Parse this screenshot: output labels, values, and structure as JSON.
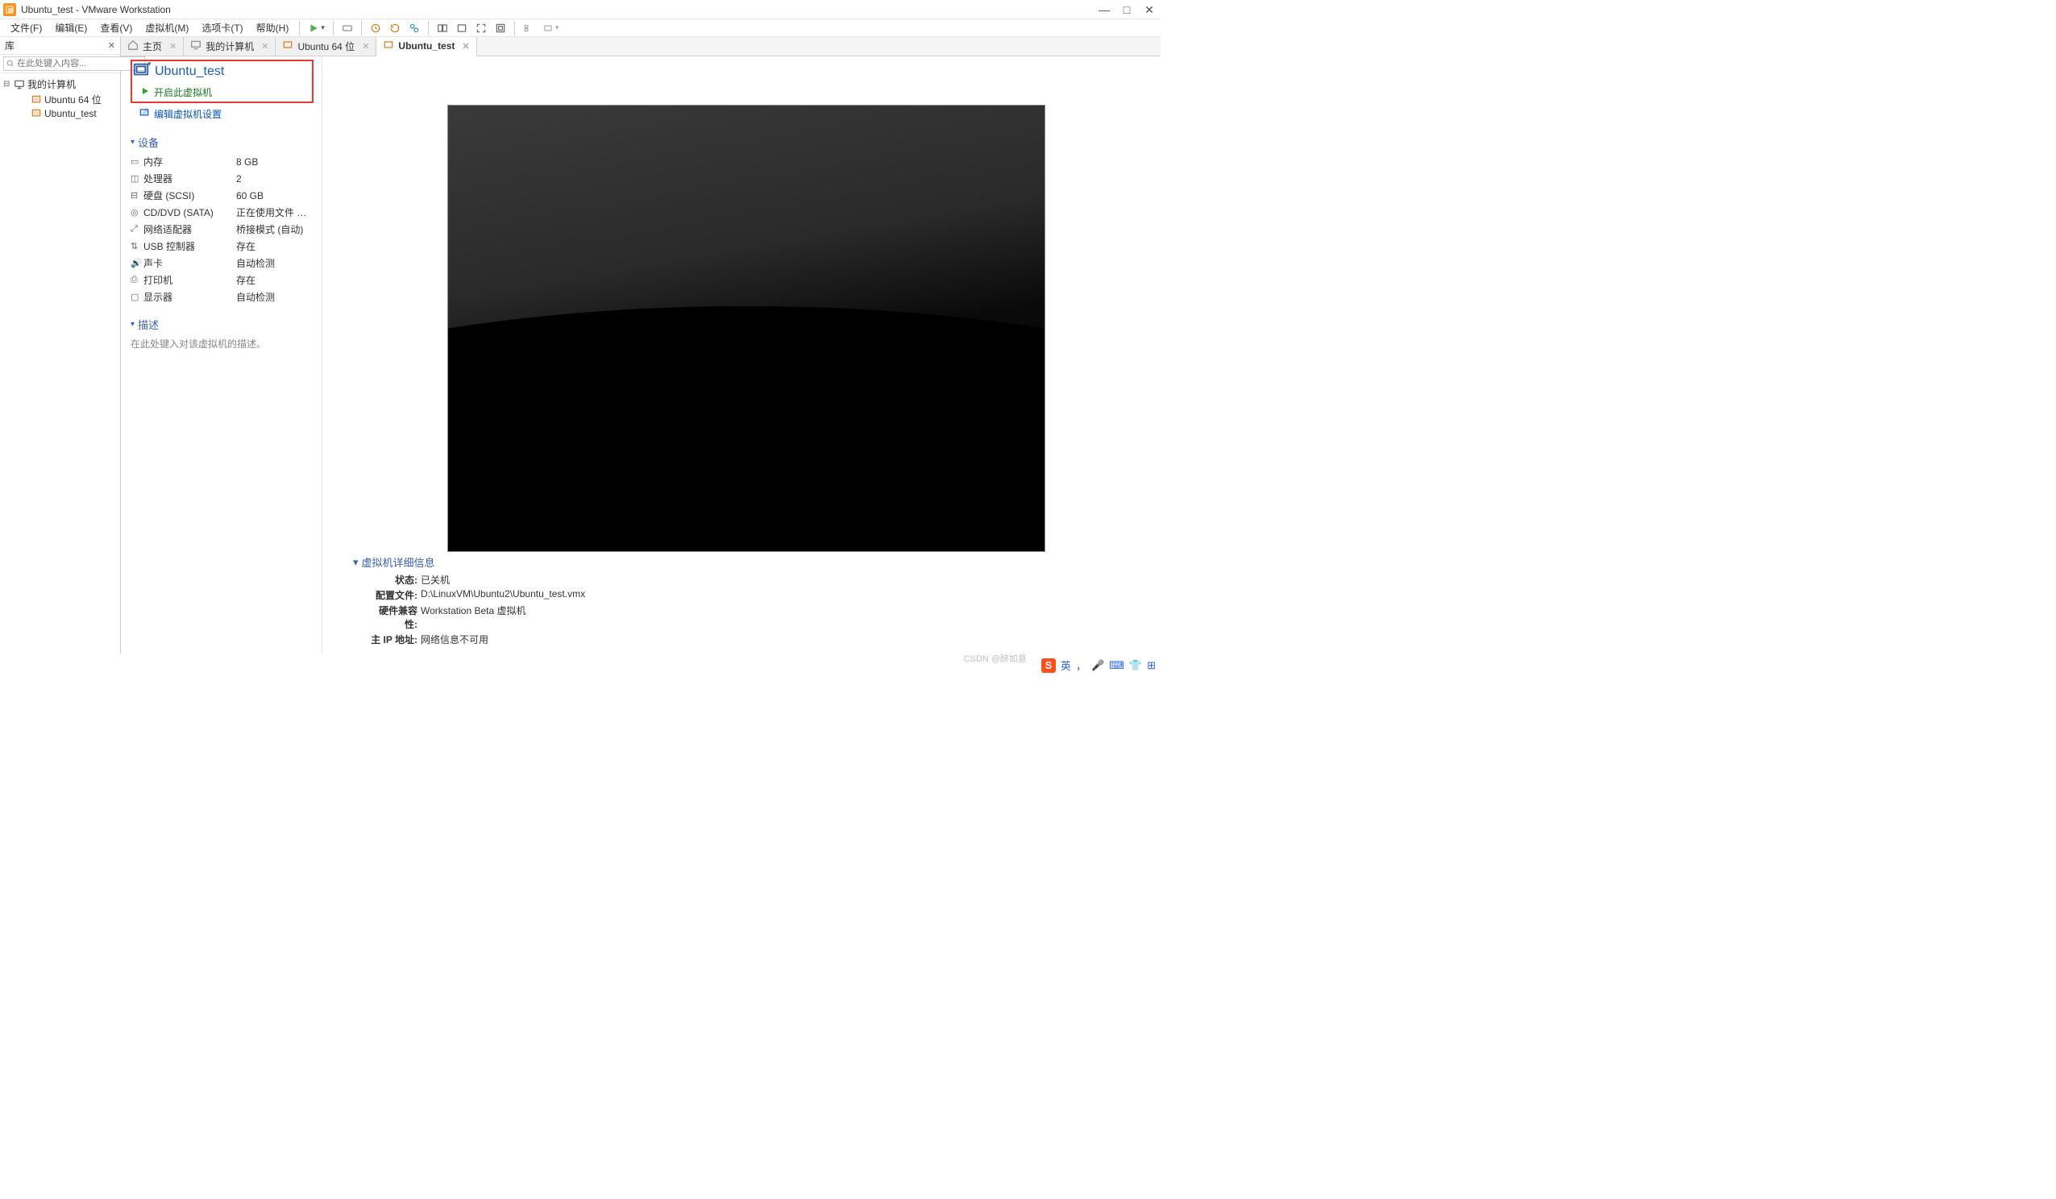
{
  "window": {
    "title": "Ubuntu_test - VMware Workstation"
  },
  "menu": {
    "file": "文件(F)",
    "edit": "编辑(E)",
    "view": "查看(V)",
    "vm": "虚拟机(M)",
    "tabs": "选项卡(T)",
    "help": "帮助(H)"
  },
  "library": {
    "header": "库",
    "search_placeholder": "在此处键入内容...",
    "root": "我的计算机",
    "nodes": {
      "ubuntu64": "Ubuntu 64 位",
      "ubuntu_test": "Ubuntu_test"
    }
  },
  "tabs": {
    "home": "主页",
    "my_computer": "我的计算机",
    "ubuntu64": "Ubuntu 64 位",
    "ubuntu_test": "Ubuntu_test"
  },
  "vm": {
    "name": "Ubuntu_test",
    "start_label": "开启此虚拟机",
    "edit_label": "编辑虚拟机设置"
  },
  "devices": {
    "header": "设备",
    "memory": {
      "label": "内存",
      "value": "8 GB"
    },
    "cpu": {
      "label": "处理器",
      "value": "2"
    },
    "disk": {
      "label": "硬盘 (SCSI)",
      "value": "60 GB"
    },
    "cd": {
      "label": "CD/DVD (SATA)",
      "value": "正在使用文件 D:..."
    },
    "net": {
      "label": "网络适配器",
      "value": "桥接模式 (自动)"
    },
    "usb": {
      "label": "USB 控制器",
      "value": "存在"
    },
    "sound": {
      "label": "声卡",
      "value": "自动检测"
    },
    "printer": {
      "label": "打印机",
      "value": "存在"
    },
    "display": {
      "label": "显示器",
      "value": "自动检测"
    }
  },
  "description": {
    "header": "描述",
    "placeholder": "在此处键入对该虚拟机的描述。"
  },
  "details": {
    "header": "虚拟机详细信息",
    "state_k": "状态:",
    "state_v": "已关机",
    "config_k": "配置文件:",
    "config_v": "D:\\LinuxVM\\Ubuntu2\\Ubuntu_test.vmx",
    "compat_k": "硬件兼容性:",
    "compat_v": "Workstation Beta 虚拟机",
    "ip_k": "主 IP 地址:",
    "ip_v": "网络信息不可用"
  },
  "watermark": "CSDN @醉如意",
  "tray": {
    "ime": "英",
    "dot": "，"
  }
}
